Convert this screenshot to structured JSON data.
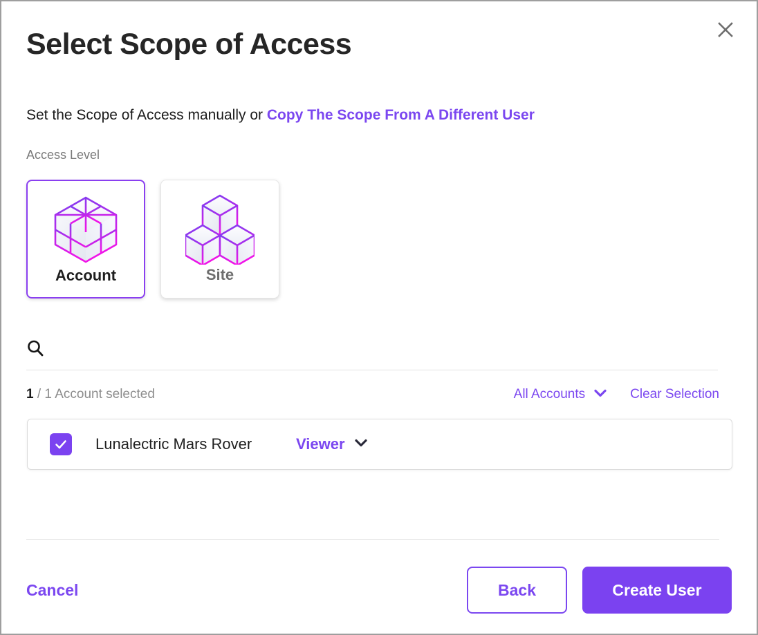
{
  "dialog": {
    "title": "Select Scope of Access",
    "close_icon": "close-icon",
    "subtitle_prefix": "Set the Scope of Access manually or ",
    "subtitle_link": "Copy The Scope From A Different User",
    "access_level_label": "Access Level"
  },
  "access_levels": [
    {
      "label": "Account",
      "icon": "cube-2x2-icon",
      "selected": true
    },
    {
      "label": "Site",
      "icon": "three-cubes-icon",
      "selected": false
    }
  ],
  "search": {
    "icon": "search-icon",
    "value": "",
    "placeholder": ""
  },
  "selection": {
    "count": "1",
    "summary": " / 1 Account selected",
    "filter_label": "All Accounts",
    "filter_icon": "chevron-down-icon",
    "clear_label": "Clear Selection"
  },
  "accounts": [
    {
      "name": "Lunalectric Mars Rover",
      "checked": true,
      "check_icon": "checkmark-icon",
      "role": "Viewer",
      "role_icon": "chevron-down-icon"
    }
  ],
  "footer": {
    "cancel_label": "Cancel",
    "back_label": "Back",
    "primary_label": "Create User"
  },
  "colors": {
    "accent_purple": "#7B42F0",
    "link_purple": "#7B47F0",
    "card_border_selected": "#8a3ff0",
    "gradient_start": "#7B3FF0",
    "gradient_end": "#E020E0",
    "text_dark": "#1f1f1f",
    "text_muted": "#8c8c8c"
  }
}
